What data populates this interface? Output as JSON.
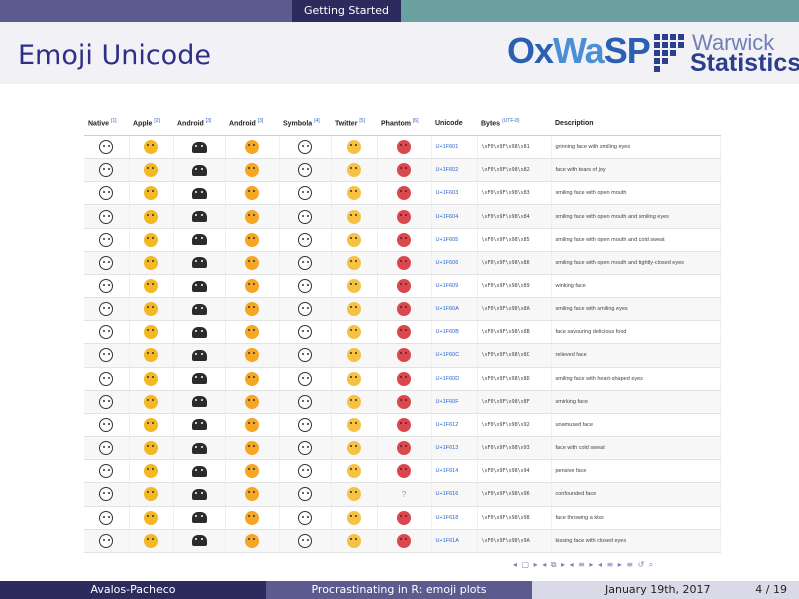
{
  "header": {
    "section": "Getting Started"
  },
  "slide": {
    "title": "Emoji Unicode"
  },
  "logos": {
    "oxwasp": "OxWaSP",
    "warwick_top": "Warwick",
    "warwick_bottom": "Statistics"
  },
  "table": {
    "columns": [
      {
        "label": "Native",
        "ref": "[1]"
      },
      {
        "label": "Apple",
        "ref": "[2]"
      },
      {
        "label": "Android",
        "ref": "[3]"
      },
      {
        "label": "Android",
        "ref": "[3]"
      },
      {
        "label": "Symbola",
        "ref": "[4]"
      },
      {
        "label": "Twitter",
        "ref": "[5]"
      },
      {
        "label": "Phantom",
        "ref": "[6]"
      },
      {
        "label": "Unicode",
        "ref": ""
      },
      {
        "label": "Bytes",
        "ref": "(UTF-8)"
      },
      {
        "label": "Description",
        "ref": ""
      }
    ],
    "rows": [
      {
        "unicode": "U+1F601",
        "bytes": "\\xF0\\x9F\\x98\\x81",
        "desc": "grinning face with smiling eyes"
      },
      {
        "unicode": "U+1F602",
        "bytes": "\\xF0\\x9F\\x98\\x82",
        "desc": "face with tears of joy"
      },
      {
        "unicode": "U+1F603",
        "bytes": "\\xF0\\x9F\\x98\\x83",
        "desc": "smiling face with open mouth"
      },
      {
        "unicode": "U+1F604",
        "bytes": "\\xF0\\x9F\\x98\\x84",
        "desc": "smiling face with open mouth and smiling eyes"
      },
      {
        "unicode": "U+1F605",
        "bytes": "\\xF0\\x9F\\x98\\x85",
        "desc": "smiling face with open mouth and cold sweat"
      },
      {
        "unicode": "U+1F606",
        "bytes": "\\xF0\\x9F\\x98\\x86",
        "desc": "smiling face with open mouth and tightly-closed eyes"
      },
      {
        "unicode": "U+1F609",
        "bytes": "\\xF0\\x9F\\x98\\x89",
        "desc": "winking face"
      },
      {
        "unicode": "U+1F60A",
        "bytes": "\\xF0\\x9F\\x98\\x8A",
        "desc": "smiling face with smiling eyes"
      },
      {
        "unicode": "U+1F60B",
        "bytes": "\\xF0\\x9F\\x98\\x8B",
        "desc": "face savouring delicious food"
      },
      {
        "unicode": "U+1F60C",
        "bytes": "\\xF0\\x9F\\x98\\x8C",
        "desc": "relieved face"
      },
      {
        "unicode": "U+1F60D",
        "bytes": "\\xF0\\x9F\\x98\\x8D",
        "desc": "smiling face with heart-shaped eyes"
      },
      {
        "unicode": "U+1F60F",
        "bytes": "\\xF0\\x9F\\x98\\x8F",
        "desc": "smirking face"
      },
      {
        "unicode": "U+1F612",
        "bytes": "\\xF0\\x9F\\x98\\x92",
        "desc": "unamused face"
      },
      {
        "unicode": "U+1F613",
        "bytes": "\\xF0\\x9F\\x98\\x93",
        "desc": "face with cold sweat"
      },
      {
        "unicode": "U+1F614",
        "bytes": "\\xF0\\x9F\\x98\\x94",
        "desc": "pensive face"
      },
      {
        "unicode": "U+1F616",
        "bytes": "\\xF0\\x9F\\x98\\x96",
        "desc": "confounded face",
        "phantom_missing": "?"
      },
      {
        "unicode": "U+1F618",
        "bytes": "\\xF0\\x9F\\x98\\x98",
        "desc": "face throwing a kiss"
      },
      {
        "unicode": "U+1F61A",
        "bytes": "\\xF0\\x9F\\x98\\x9A",
        "desc": "kissing face with closed eyes"
      }
    ]
  },
  "footer": {
    "author": "Avalos-Pacheco",
    "talk": "Procrastinating in R: emoji plots",
    "date": "January 19th, 2017",
    "page": "4 / 19"
  },
  "nav_symbols": "◂ ▢ ▸ ◂ ⧉ ▸ ◂ ≡ ▸ ◂ ≡ ▸ ≡ ↺ ⌕"
}
